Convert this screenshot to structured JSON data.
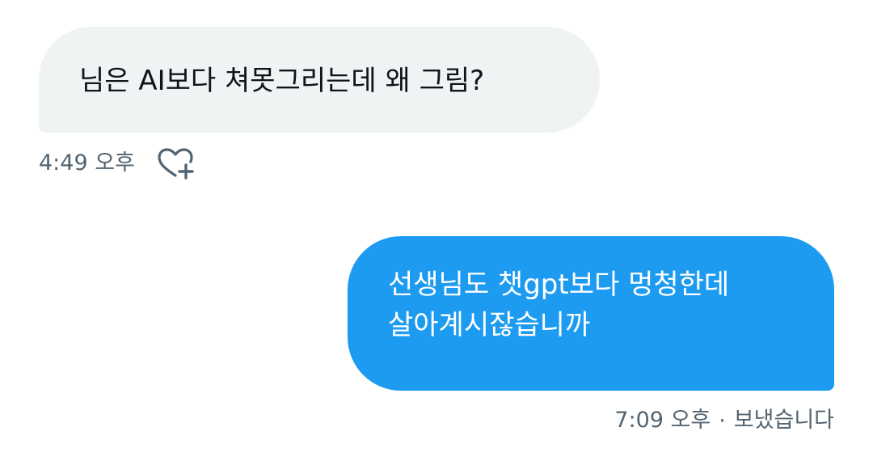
{
  "conversation": {
    "received": {
      "text": "님은 AI보다 쳐못그리는데 왜 그림?",
      "time": "4:49 오후",
      "reaction_icon": "heart-plus-icon"
    },
    "sent": {
      "lines": [
        "선생님도 챗gpt보다 멍청한데",
        "살아계시잖습니까"
      ],
      "time": "7:09 오후",
      "separator": "·",
      "status": "보냈습니다"
    }
  },
  "colors": {
    "received_bubble": "#eff3f4",
    "sent_bubble": "#1d9bf0",
    "meta_text": "#536471",
    "primary_text": "#0f1419"
  }
}
